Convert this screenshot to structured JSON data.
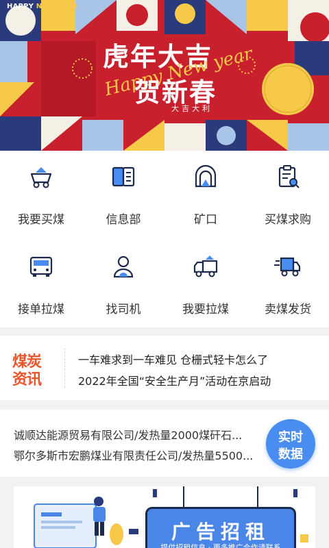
{
  "banner": {
    "tag_prefix": "HAPPY ",
    "tag_highlight": "NEW YEAR",
    "title_line1": "虎年大吉",
    "title_line2": "贺新春",
    "script_text": "Happy New year",
    "small_text": "大吉大利"
  },
  "grid": {
    "items": [
      {
        "label": "我要买煤",
        "icon": "coal-cart-icon"
      },
      {
        "label": "信息部",
        "icon": "book-icon"
      },
      {
        "label": "矿口",
        "icon": "mine-entrance-icon"
      },
      {
        "label": "买煤求购",
        "icon": "clipboard-search-icon"
      },
      {
        "label": "接单拉煤",
        "icon": "truck-front-icon"
      },
      {
        "label": "找司机",
        "icon": "driver-icon"
      },
      {
        "label": "我要拉煤",
        "icon": "dump-truck-icon"
      },
      {
        "label": "卖煤发货",
        "icon": "delivery-truck-icon"
      }
    ]
  },
  "news": {
    "logo_line1": "煤炭",
    "logo_line2": "资讯",
    "items": [
      "一车难求到一车难见 仓栅式轻卡怎么了",
      "2022年全国“安全生产月”活动在京启动"
    ]
  },
  "realtime": {
    "items": [
      "诚顺达能源贸易有限公司/发热量2000煤矸石...",
      "鄂尔多斯市宏鹏煤业有限责任公司/发热量5500..."
    ],
    "button_line1": "实时",
    "button_line2": "数据"
  },
  "ad": {
    "title": "广告招租",
    "subtitle": "提供招租信息 · 更多推广合作请联系"
  },
  "colors": {
    "accent": "#4a8df0",
    "banner_red": "#c8202c",
    "news_orange": "#e8562c",
    "icon_dark": "#1b2a4a"
  }
}
